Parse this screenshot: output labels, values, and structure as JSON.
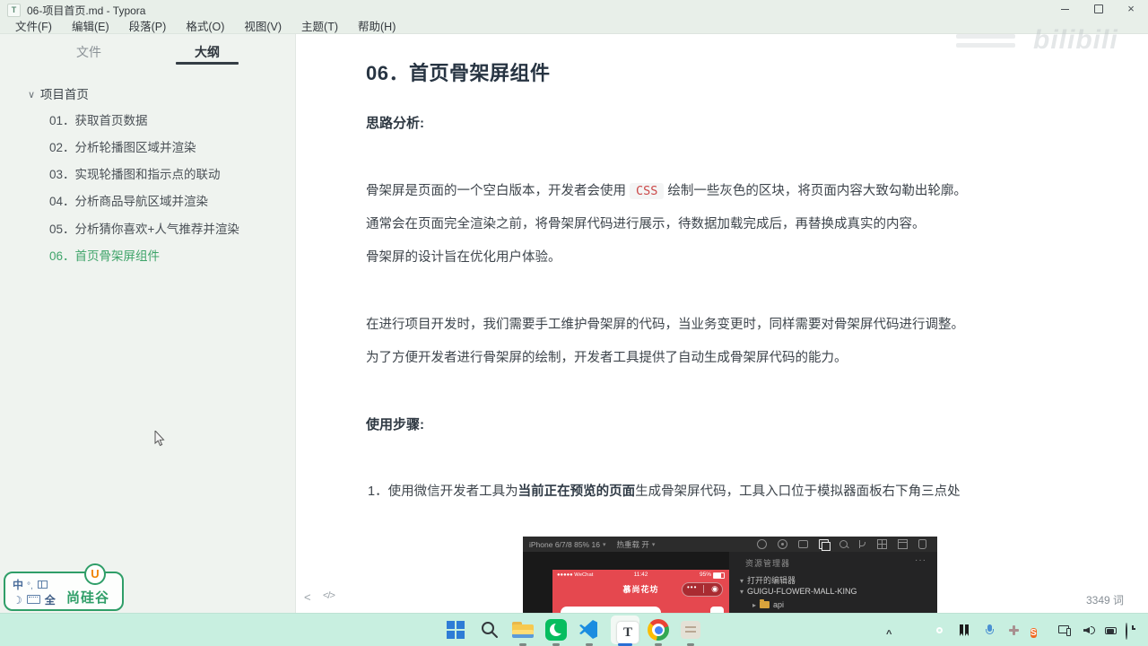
{
  "window": {
    "app_initial": "T",
    "title": "06-项目首页.md - Typora",
    "menu": [
      "文件(F)",
      "编辑(E)",
      "段落(P)",
      "格式(O)",
      "视图(V)",
      "主题(T)",
      "帮助(H)"
    ],
    "close_glyph": "×"
  },
  "sidebar": {
    "tab_files": "文件",
    "tab_outline": "大纲",
    "outline_caret": "∨",
    "outline_root": "项目首页",
    "items": [
      {
        "label": "01．获取首页数据"
      },
      {
        "label": "02．分析轮播图区域并渲染"
      },
      {
        "label": "03．实现轮播图和指示点的联动"
      },
      {
        "label": "04．分析商品导航区域并渲染"
      },
      {
        "label": "05．分析猜你喜欢+人气推荐并渲染"
      },
      {
        "label": "06．首页骨架屏组件"
      }
    ],
    "active_color": "#3fa46a"
  },
  "content": {
    "heading": "06．首页骨架屏组件",
    "analysis_title": "思路分析:",
    "p1_a": "骨架屏是页面的一个空白版本，开发者会使用",
    "p1_code": "CSS",
    "p1_b": "绘制一些灰色的区块，将页面内容大致勾勒出轮廓。",
    "p2": "通常会在页面完全渲染之前，将骨架屏代码进行展示，待数据加载完成后，再替换成真实的内容。",
    "p3": "骨架屏的设计旨在优化用户体验。",
    "p4": "在进行项目开发时，我们需要手工维护骨架屏的代码，当业务变更时，同样需要对骨架屏代码进行调整。",
    "p5": "为了方便开发者进行骨架屏的绘制，开发者工具提供了自动生成骨架屏代码的能力。",
    "steps_title": "使用步骤:",
    "step1_num": "1．",
    "step1_a": "使用微信开发者工具为",
    "step1_bold": "当前正在预览的页面",
    "step1_b": "生成骨架屏代码，工具入口位于模拟器面板右下角三点处"
  },
  "screenshot": {
    "device": "iPhone 6/7/8 85% 16",
    "device_caret": "▾",
    "hot_reload": "热重载 开",
    "phone": {
      "carrier": "●●●●● WeChat",
      "time": "11:42",
      "battery": "95%",
      "nav_title": "慕尚花坊",
      "capsule_dots": "•••",
      "capsule_target": "◉"
    },
    "explorer": {
      "header": "资源管理器",
      "menu_dots": "···",
      "open_arrow": "▾",
      "open_editors": "打开的编辑器",
      "project_arrow": "▾",
      "project": "GUIGU-FLOWER-MALL-KING",
      "folder_arrow": "▸",
      "folder": "api"
    }
  },
  "footer": {
    "collapse_glyph": "<",
    "source_glyph": "</>",
    "word_count": "3349 词"
  },
  "overlays": {
    "bilibili": "bilibili",
    "ime_cn": "中",
    "ime_punct": "°,",
    "ime_moon": "☽",
    "ime_full": "全",
    "brand_u": "U",
    "brand": "尚硅谷"
  }
}
